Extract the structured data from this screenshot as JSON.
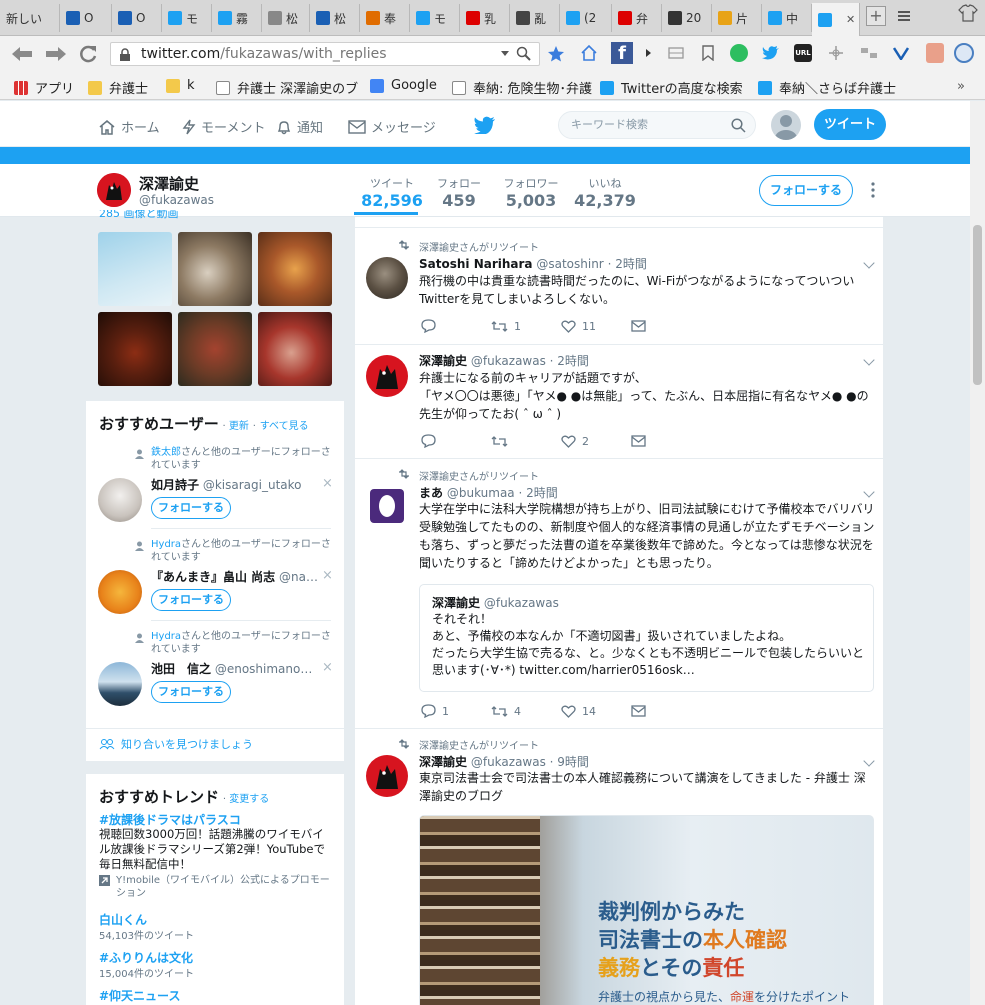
{
  "browser": {
    "tabs": [
      {
        "label": "新しい",
        "color": "#999"
      },
      {
        "label": "O",
        "color": "#1a5fb4"
      },
      {
        "label": "O",
        "color": "#1a5fb4"
      },
      {
        "label": "モ",
        "color": "#1da1f2"
      },
      {
        "label": "霧",
        "color": "#1da1f2"
      },
      {
        "label": "松",
        "color": "#888"
      },
      {
        "label": "松",
        "color": "#1a5fb4"
      },
      {
        "label": "奉",
        "color": "#e06c00"
      },
      {
        "label": "モ",
        "color": "#1da1f2"
      },
      {
        "label": "乳",
        "color": "#d00"
      },
      {
        "label": "亂",
        "color": "#444"
      },
      {
        "label": "(2",
        "color": "#1da1f2"
      },
      {
        "label": "弁",
        "color": "#d00"
      },
      {
        "label": "20",
        "color": "#333"
      },
      {
        "label": "片",
        "color": "#e8a317"
      },
      {
        "label": "中",
        "color": "#1da1f2"
      },
      {
        "label": "",
        "color": "#1da1f2"
      }
    ],
    "url_domain": "twitter.com",
    "url_path": "/fukazawas/with_replies",
    "bookmarks": [
      {
        "label": "アプリ",
        "icon": "apps-grid-icon"
      },
      {
        "label": "弁護士",
        "icon": "folder-icon"
      },
      {
        "label": "k",
        "icon": "folder-icon"
      },
      {
        "label": "弁護士 深澤諭史のブ",
        "icon": "page-icon"
      },
      {
        "label": "Google",
        "icon": "google-icon"
      },
      {
        "label": "奉納: 危険生物･弁護",
        "icon": "page-icon"
      },
      {
        "label": "Twitterの高度な検索",
        "icon": "twitter-icon"
      },
      {
        "label": "奉納＼さらば弁護士",
        "icon": "twitter-icon"
      }
    ]
  },
  "nav": {
    "home": "ホーム",
    "moments": "モーメント",
    "notifications": "通知",
    "messages": "メッセージ",
    "search_placeholder": "キーワード検索",
    "tweet_button": "ツイート"
  },
  "profile": {
    "name": "深澤諭史",
    "handle": "@fukazawas",
    "stats": [
      {
        "label": "ツイート",
        "value": "82,596"
      },
      {
        "label": "フォロー",
        "value": "459"
      },
      {
        "label": "フォロワー",
        "value": "5,003"
      },
      {
        "label": "いいね",
        "value": "42,379"
      }
    ],
    "follow_button": "フォローする"
  },
  "media": {
    "header": "285 画像と動画"
  },
  "suggestions": {
    "title": "おすすめユーザー",
    "refresh": "更新",
    "separator": "·",
    "view_all": "すべて見る",
    "items": [
      {
        "ctx_name": "鉄太郎",
        "ctx_text": "さんと他のユーザーにフォローされています",
        "name": "如月詩子",
        "handle": "@kisaragi_utako",
        "follow": "フォローする"
      },
      {
        "ctx_name": "Hydra",
        "ctx_text": "さんと他のユーザーにフォローされています",
        "name": "『あんまき』畠山 尚志",
        "handle": "@na…",
        "follow": "フォローする"
      },
      {
        "ctx_name": "Hydra",
        "ctx_text": "さんと他のユーザーにフォローされています",
        "name": "池田　信之",
        "handle": "@enoshimano…",
        "follow": "フォローする"
      }
    ],
    "find_friends": "知り合いを見つけましょう"
  },
  "trends": {
    "title": "おすすめトレンド",
    "change": "変更する",
    "items": [
      {
        "tag": "#放課後ドラマはパラスコ",
        "desc": "視聴回数3000万回！話題沸騰のワイモバイル放課後ドラマシリーズ第2弾！YouTubeで毎日無料配信中！",
        "promo": "Y!mobile（ワイモバイル）公式によるプロモーション"
      },
      {
        "tag": "白山くん",
        "count": "54,103件のツイート"
      },
      {
        "tag": "#ふりりんは文化",
        "count": "15,004件のツイート"
      },
      {
        "tag": "#仰天ニュース"
      }
    ]
  },
  "tweets": [
    {
      "rt": "深澤諭史さんがリツイート",
      "name": "Satoshi Narihara",
      "handle": "@satoshinr",
      "time": "· 2時間",
      "text": "飛行機の中は貴重な読書時間だったのに、Wi-Fiがつながるようになってついつい Twitterを見てしまいよろしくない。",
      "reply": "",
      "retweet": "1",
      "like": "11"
    },
    {
      "rt": "",
      "name": "深澤諭史",
      "handle": "@fukazawas",
      "time": "· 2時間",
      "text": "弁護士になる前のキャリアが話題ですが、\n「ヤメ〇〇は悪徳」「ヤメ● ●は無能」って、たぶん、日本屈指に有名なヤメ● ●の先生が仰ってたお( ˆ ω ˆ )",
      "reply": "",
      "retweet": "",
      "like": "2"
    },
    {
      "rt": "深澤諭史さんがリツイート",
      "name": "まあ",
      "handle": "@bukumaa",
      "time": "· 2時間",
      "text": "大学在学中に法科大学院構想が持ち上がり、旧司法試験にむけて予備校本でバリバリ受験勉強してたものの、新制度や個人的な経済事情の見通しが立たずモチベーションも落ち、ずっと夢だった法曹の道を卒業後数年で諦めた。今となっては悲惨な状況を聞いたりすると「諦めたけどよかった」とも思ったり。",
      "quote": {
        "name": "深澤諭史",
        "handle": "@fukazawas",
        "text": "それそれ！\nあと、予備校の本なんか「不適切図書」扱いされていましたよね。\nだったら大学生協で売るな、と。少なくとも不透明ビニールで包装したらいいと思います(･∀･*) twitter.com/harrier0516osk…"
      },
      "reply": "1",
      "retweet": "4",
      "like": "14"
    },
    {
      "rt": "深澤諭史さんがリツイート",
      "name": "深澤諭史",
      "handle": "@fukazawas",
      "time": "· 9時間",
      "text": "東京司法書士会で司法書士の本人確認義務について講演をしてきました - 弁護士 深澤諭史のブログ",
      "card": {
        "line1": "裁判例からみた",
        "line2a": "司法書士の",
        "line2b": "本人確認",
        "line3a": "義務",
        "line3b": "とその",
        "line3c": "責任",
        "sub_a": "弁護士の視点から見た、",
        "sub_b": "命運",
        "sub_c": "を分けたポイント"
      }
    }
  ]
}
